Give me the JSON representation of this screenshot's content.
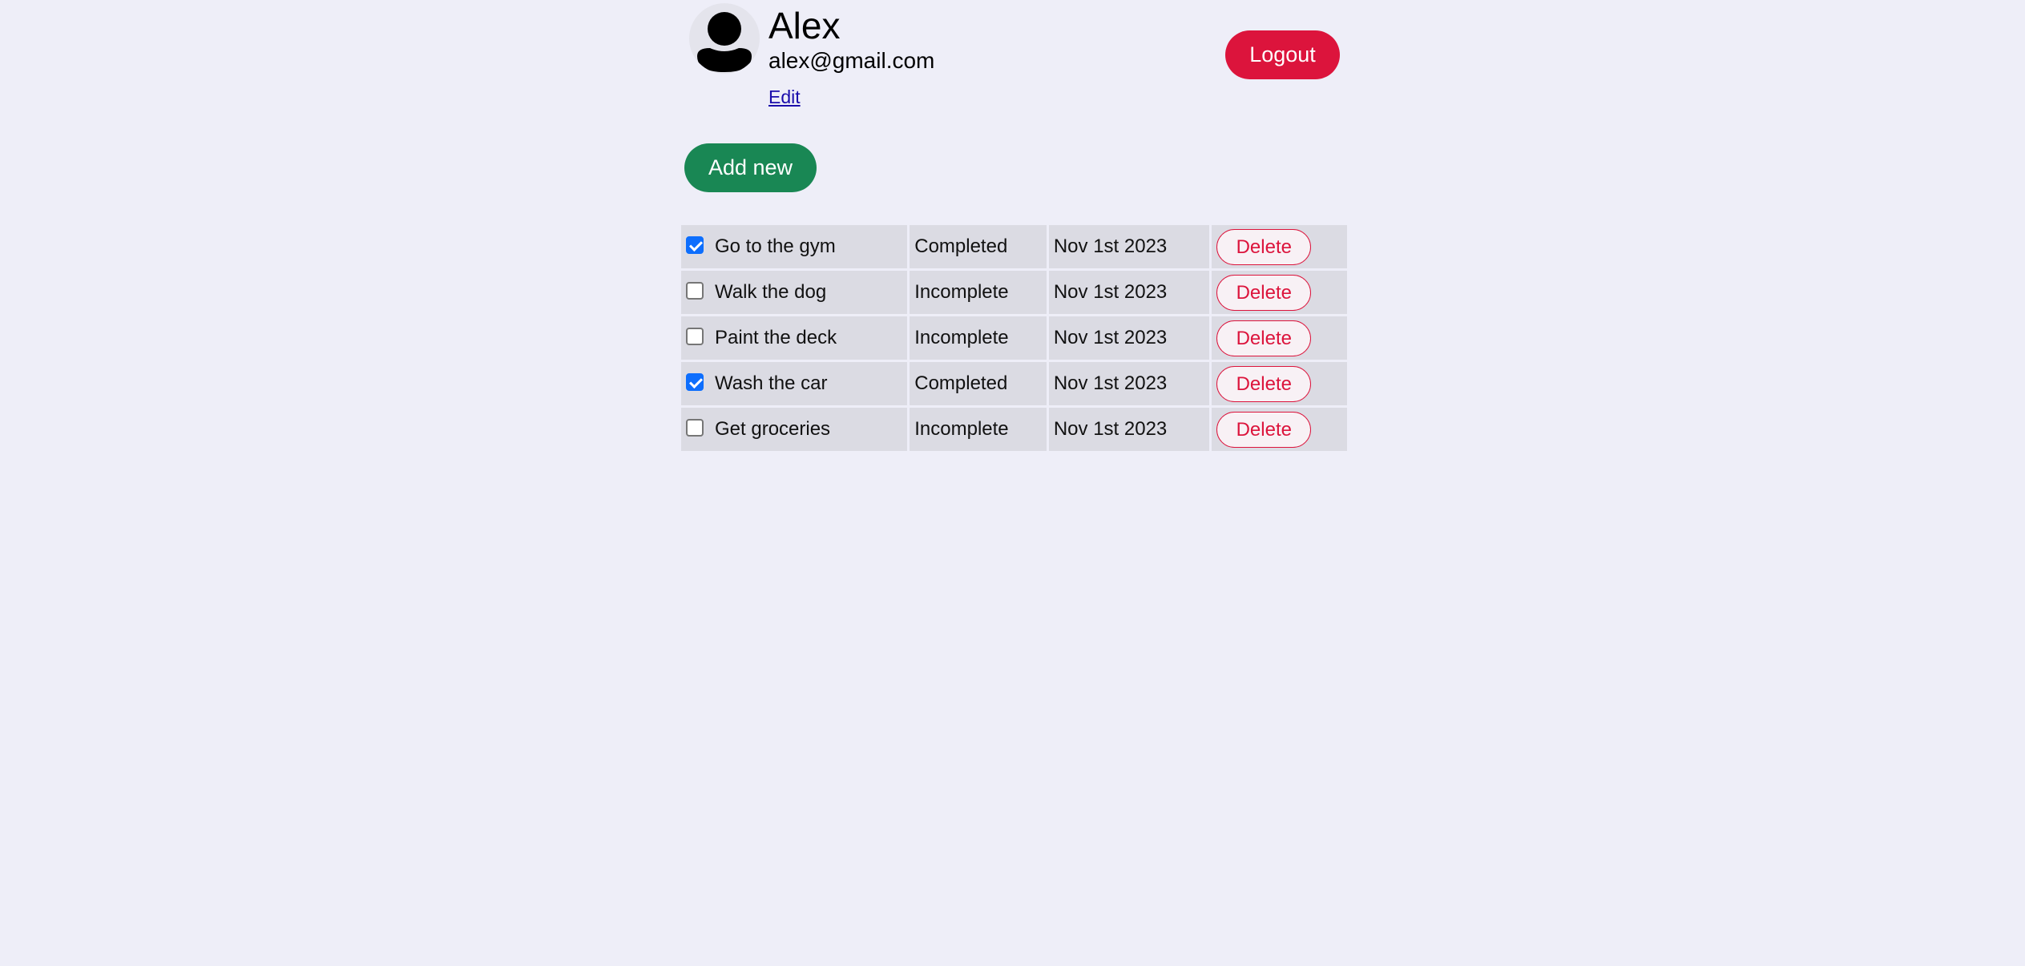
{
  "profile": {
    "name": "Alex",
    "email": "alex@gmail.com",
    "edit_label": "Edit",
    "avatar_icon": "user-silhouette-icon"
  },
  "header": {
    "logout_label": "Logout"
  },
  "actions": {
    "add_new_label": "Add new"
  },
  "colors": {
    "background": "#eeeef8",
    "logout": "#dc143c",
    "add_new": "#198754",
    "checkbox_checked": "#0d6efd",
    "delete": "#dc143c"
  },
  "todos": [
    {
      "title": "Go to the gym",
      "checked": true,
      "status": "Completed",
      "date": "Nov 1st 2023",
      "delete_label": "Delete"
    },
    {
      "title": "Walk the dog",
      "checked": false,
      "status": "Incomplete",
      "date": "Nov 1st 2023",
      "delete_label": "Delete"
    },
    {
      "title": "Paint the deck",
      "checked": false,
      "status": "Incomplete",
      "date": "Nov 1st 2023",
      "delete_label": "Delete"
    },
    {
      "title": "Wash the car",
      "checked": true,
      "status": "Completed",
      "date": "Nov 1st 2023",
      "delete_label": "Delete"
    },
    {
      "title": "Get groceries",
      "checked": false,
      "status": "Incomplete",
      "date": "Nov 1st 2023",
      "delete_label": "Delete"
    }
  ]
}
